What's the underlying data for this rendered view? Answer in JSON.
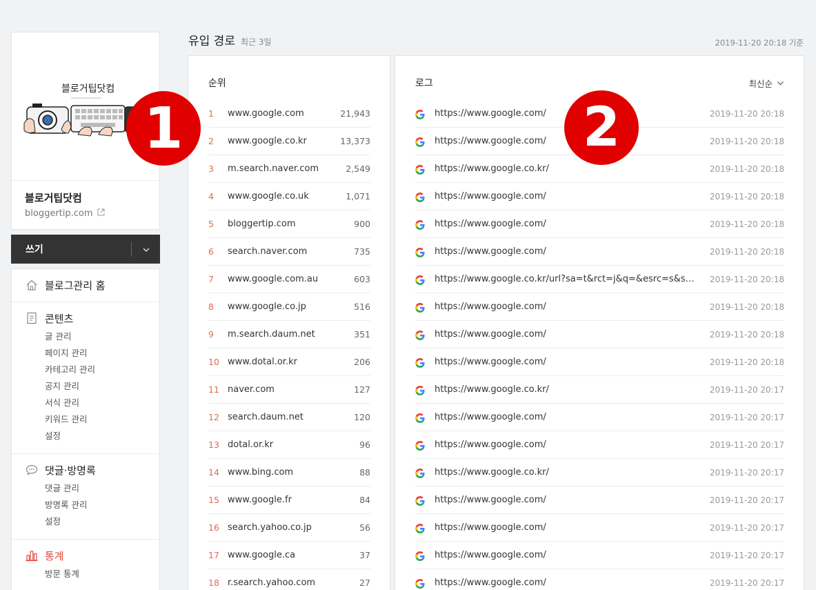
{
  "sidebar": {
    "logo_text": "블로거팁닷컴",
    "blog_name": "블로거팁닷컴",
    "blog_url": "bloggertip.com",
    "write_label": "쓰기",
    "menu": [
      {
        "icon": "home-icon",
        "label": "블로그관리 홈",
        "items": []
      },
      {
        "icon": "document-icon",
        "label": "콘텐츠",
        "items": [
          "글 관리",
          "페이지 관리",
          "카테고리 관리",
          "공지 관리",
          "서식 관리",
          "키워드 관리",
          "설정"
        ]
      },
      {
        "icon": "speech-bubble-icon",
        "label": "댓글·방명록",
        "items": [
          "댓글 관리",
          "방명록 관리",
          "설정"
        ]
      },
      {
        "icon": "bar-chart-icon",
        "label": "통계",
        "items": [
          "방문 통계"
        ]
      }
    ]
  },
  "main": {
    "title": "유입 경로",
    "subtitle": "최근 3일",
    "basis": "2019-11-20 20:18 기준",
    "rank_header": "순위",
    "log_header": "로그",
    "sort_label": "최신순",
    "ranks": [
      {
        "no": "1",
        "domain": "www.google.com",
        "count": "21,943"
      },
      {
        "no": "2",
        "domain": "www.google.co.kr",
        "count": "13,373"
      },
      {
        "no": "3",
        "domain": "m.search.naver.com",
        "count": "2,549"
      },
      {
        "no": "4",
        "domain": "www.google.co.uk",
        "count": "1,071"
      },
      {
        "no": "5",
        "domain": "bloggertip.com",
        "count": "900"
      },
      {
        "no": "6",
        "domain": "search.naver.com",
        "count": "735"
      },
      {
        "no": "7",
        "domain": "www.google.com.au",
        "count": "603"
      },
      {
        "no": "8",
        "domain": "www.google.co.jp",
        "count": "516"
      },
      {
        "no": "9",
        "domain": "m.search.daum.net",
        "count": "351"
      },
      {
        "no": "10",
        "domain": "www.dotal.or.kr",
        "count": "206"
      },
      {
        "no": "11",
        "domain": "naver.com",
        "count": "127"
      },
      {
        "no": "12",
        "domain": "search.daum.net",
        "count": "120"
      },
      {
        "no": "13",
        "domain": "dotal.or.kr",
        "count": "96"
      },
      {
        "no": "14",
        "domain": "www.bing.com",
        "count": "88"
      },
      {
        "no": "15",
        "domain": "www.google.fr",
        "count": "84"
      },
      {
        "no": "16",
        "domain": "search.yahoo.co.jp",
        "count": "56"
      },
      {
        "no": "17",
        "domain": "www.google.ca",
        "count": "37"
      },
      {
        "no": "18",
        "domain": "r.search.yahoo.com",
        "count": "27"
      }
    ],
    "logs": [
      {
        "url": "https://www.google.com/",
        "time": "2019-11-20 20:18"
      },
      {
        "url": "https://www.google.com/",
        "time": "2019-11-20 20:18"
      },
      {
        "url": "https://www.google.co.kr/",
        "time": "2019-11-20 20:18"
      },
      {
        "url": "https://www.google.com/",
        "time": "2019-11-20 20:18"
      },
      {
        "url": "https://www.google.com/",
        "time": "2019-11-20 20:18"
      },
      {
        "url": "https://www.google.com/",
        "time": "2019-11-20 20:18"
      },
      {
        "url": "https://www.google.co.kr/url?sa=t&rct=j&q=&esrc=s&source=web&cd=",
        "time": "2019-11-20 20:18"
      },
      {
        "url": "https://www.google.com/",
        "time": "2019-11-20 20:18"
      },
      {
        "url": "https://www.google.com/",
        "time": "2019-11-20 20:18"
      },
      {
        "url": "https://www.google.com/",
        "time": "2019-11-20 20:18"
      },
      {
        "url": "https://www.google.co.kr/",
        "time": "2019-11-20 20:17"
      },
      {
        "url": "https://www.google.com/",
        "time": "2019-11-20 20:17"
      },
      {
        "url": "https://www.google.com/",
        "time": "2019-11-20 20:17"
      },
      {
        "url": "https://www.google.co.kr/",
        "time": "2019-11-20 20:17"
      },
      {
        "url": "https://www.google.com/",
        "time": "2019-11-20 20:17"
      },
      {
        "url": "https://www.google.com/",
        "time": "2019-11-20 20:17"
      },
      {
        "url": "https://www.google.com/",
        "time": "2019-11-20 20:17"
      },
      {
        "url": "https://www.google.com/",
        "time": "2019-11-20 20:17"
      }
    ]
  },
  "annotations": {
    "badge_1": "1",
    "badge_2": "2"
  },
  "colors": {
    "accent": "#e3473b",
    "rank_number": "#e46a4f",
    "badge": "#e00000",
    "write_button": "#333333"
  }
}
